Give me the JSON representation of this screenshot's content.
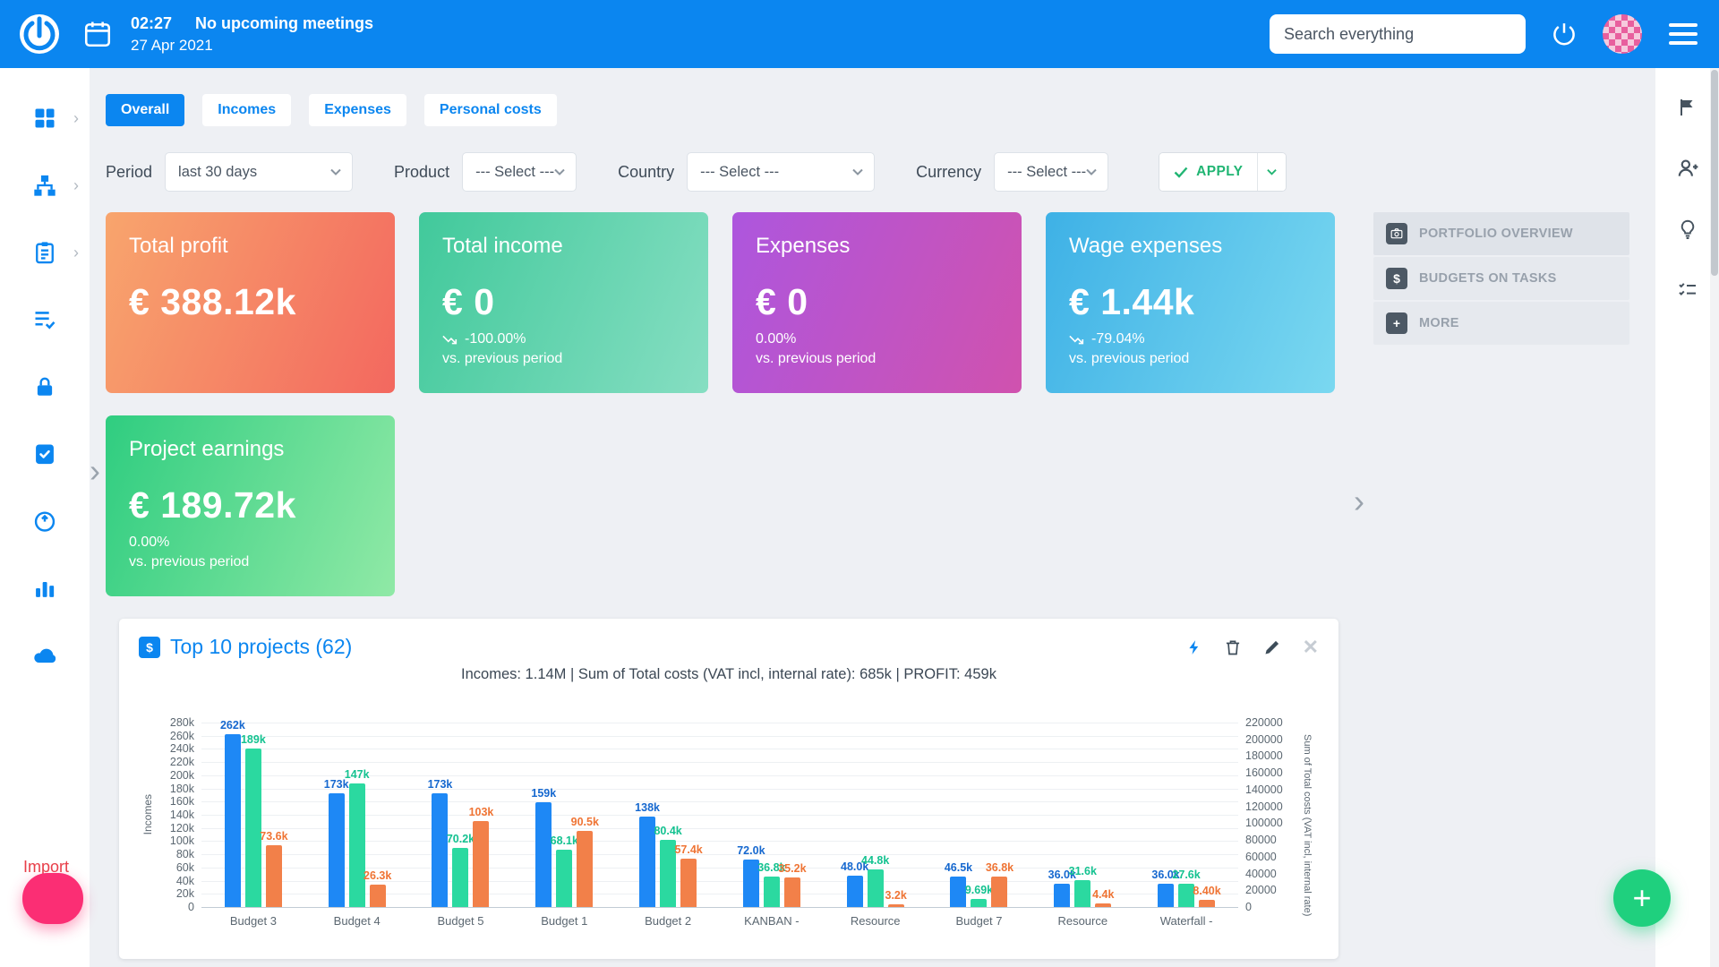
{
  "colors": {
    "topbar_blue": "#0b86f0",
    "accent_blue": "#0b86f0",
    "apply_green": "#21b573",
    "fab_green": "#1fd07e",
    "chat_pink": "#fb2e74"
  },
  "topbar": {
    "time": "02:27",
    "meeting_status": "No upcoming meetings",
    "date": "27 Apr 2021",
    "search_placeholder": "Search everything",
    "icons": [
      "app-logo",
      "calendar-icon",
      "power-icon",
      "avatar",
      "menu-icon"
    ]
  },
  "left_sidebar": {
    "icons": [
      "dashboard-icon",
      "hierarchy-icon",
      "clipboard-icon",
      "task-list-icon",
      "lock-icon",
      "approved-task-icon",
      "time-target-icon",
      "bar-chart-icon",
      "cloud-icon"
    ]
  },
  "right_rail": {
    "icons": [
      "flag-icon",
      "add-user-icon",
      "lightbulb-icon",
      "checklist-icon"
    ]
  },
  "tabs": [
    {
      "label": "Overall",
      "active": true
    },
    {
      "label": "Incomes",
      "active": false
    },
    {
      "label": "Expenses",
      "active": false
    },
    {
      "label": "Personal costs",
      "active": false
    }
  ],
  "filters": {
    "period": {
      "label": "Period",
      "value": "last 30 days"
    },
    "product": {
      "label": "Product",
      "value": "--- Select ---"
    },
    "country": {
      "label": "Country",
      "value": "--- Select ---"
    },
    "currency": {
      "label": "Currency",
      "value": "--- Select ---"
    },
    "apply_label": "APPLY"
  },
  "kpis": [
    {
      "title": "Total profit",
      "value": "€ 388.12k",
      "delta": "",
      "trend": "none",
      "note": "",
      "gradient": [
        "#f8a56d",
        "#f3685f"
      ]
    },
    {
      "title": "Total income",
      "value": "€ 0",
      "delta": "-100.00%",
      "trend": "down",
      "note": "vs. previous period",
      "gradient": [
        "#41c99b",
        "#86dec2"
      ]
    },
    {
      "title": "Expenses",
      "value": "€ 0",
      "delta": "0.00%",
      "trend": "none",
      "note": "vs. previous period",
      "gradient": [
        "#ad56de",
        "#d052ae"
      ]
    },
    {
      "title": "Wage expenses",
      "value": "€ 1.44k",
      "delta": "-79.04%",
      "trend": "down",
      "note": "vs. previous period",
      "gradient": [
        "#3eb1e6",
        "#7ad8f0"
      ]
    },
    {
      "title": "Project earnings",
      "value": "€ 189.72k",
      "delta": "0.00%",
      "trend": "none",
      "note": "vs. previous period",
      "gradient": [
        "#2fcd80",
        "#90e9a6"
      ]
    }
  ],
  "side_panel": {
    "items": [
      {
        "label": "PORTFOLIO OVERVIEW",
        "icon": "portfolio-camera"
      },
      {
        "label": "BUDGETS ON TASKS",
        "icon": "budget-dollar"
      },
      {
        "label": "MORE",
        "icon": "plus"
      }
    ]
  },
  "chart_card": {
    "title": "Top 10 projects (62)",
    "subtitle": "Incomes: 1.14M | Sum of Total costs (VAT incl, internal rate): 685k | PROFIT: 459k",
    "toolbar_icons": [
      "flash-icon",
      "delete-icon",
      "edit-icon",
      "close-icon"
    ]
  },
  "chart_data": {
    "type": "bar",
    "categories": [
      "Budget 3",
      "Budget 4",
      "Budget 5",
      "Budget 1",
      "Budget 2",
      "KANBAN -",
      "Resource",
      "Budget 7",
      "Resource",
      "Waterfall -"
    ],
    "series": [
      {
        "name": "Incomes",
        "axis": "left",
        "color": "#1e88f5",
        "label_color": "#1668cf",
        "values": [
          262000,
          173000,
          173000,
          159000,
          138000,
          72000,
          48000,
          46500,
          36000,
          36000
        ],
        "labels": [
          "262k",
          "173k",
          "173k",
          "159k",
          "138k",
          "72.0k",
          "48.0k",
          "46.5k",
          "36.0k",
          "36.0k"
        ]
      },
      {
        "name": "Total costs (VAT incl, internal rate)",
        "axis": "right",
        "color": "#2bd9a0",
        "label_color": "#14c290",
        "values": [
          189000,
          147000,
          70200,
          68100,
          80400,
          36800,
          44800,
          9690,
          31600,
          27600
        ],
        "labels": [
          "189k",
          "147k",
          "70.2k",
          "68.1k",
          "80.4k",
          "36.8k",
          "44.8k",
          "9.69k",
          "31.6k",
          "27.6k"
        ]
      },
      {
        "name": "Profit",
        "axis": "right",
        "color": "#f28049",
        "label_color": "#ef7434",
        "values": [
          73600,
          26300,
          103000,
          90500,
          57400,
          35200,
          3200,
          36800,
          4400,
          8400
        ],
        "labels": [
          "73.6k",
          "26.3k",
          "103k",
          "90.5k",
          "57.4k",
          "35.2k",
          "3.2k",
          "36.8k",
          "4.4k",
          "8.40k"
        ]
      }
    ],
    "left_axis": {
      "label": "Incomes",
      "max": 280000,
      "ticks": [
        "280k",
        "260k",
        "240k",
        "220k",
        "200k",
        "180k",
        "160k",
        "140k",
        "120k",
        "100k",
        "80k",
        "60k",
        "40k",
        "20k",
        "0"
      ]
    },
    "right_axis": {
      "label": "Sum of Total costs (VAT incl, internal rate)",
      "max": 220000,
      "ticks": [
        "220000",
        "200000",
        "180000",
        "160000",
        "140000",
        "120000",
        "100000",
        "80000",
        "60000",
        "40000",
        "20000",
        "0"
      ]
    },
    "grid": true,
    "legend_position": "none"
  },
  "floating": {
    "import_label": "Import",
    "fab_plus": "+"
  }
}
